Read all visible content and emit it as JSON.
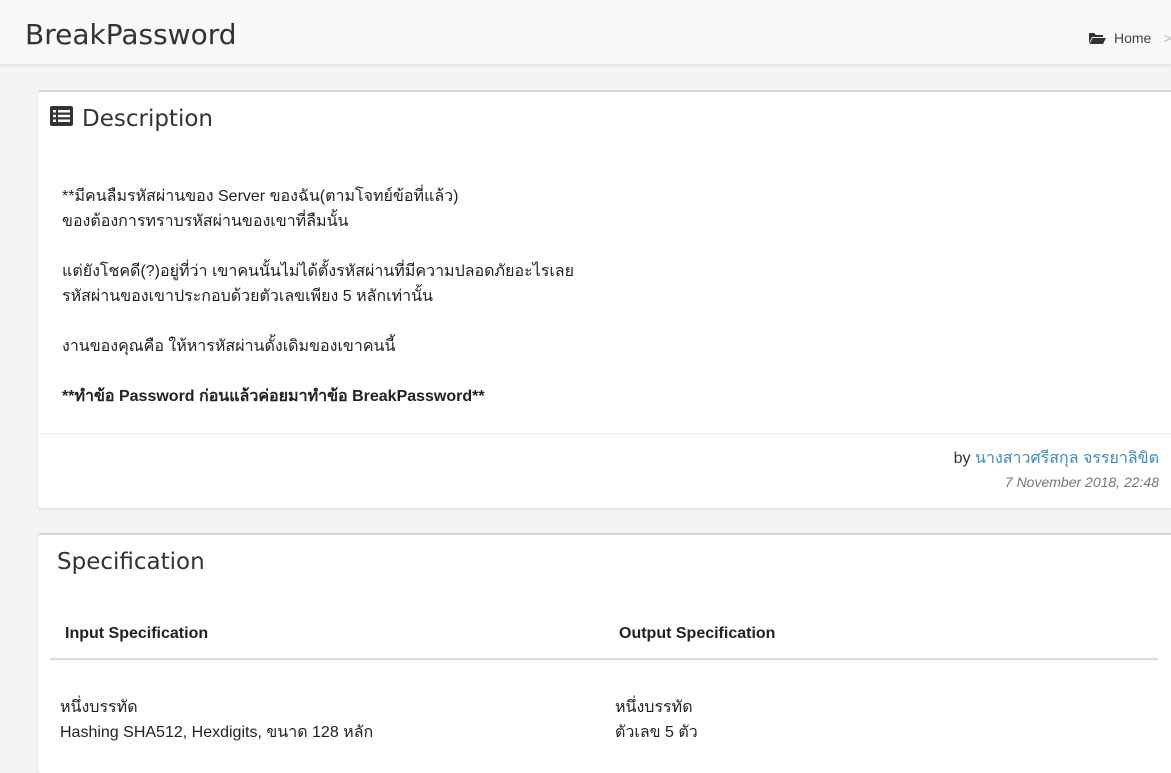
{
  "header": {
    "title": "BreakPassword",
    "breadcrumb": {
      "home_label": "Home",
      "separator": ">"
    }
  },
  "description": {
    "title": "Description",
    "lines": [
      "**มีคนลืมรหัสผ่านของ Server ของฉัน(ตามโจทย์ข้อที่แล้ว)",
      "ของต้องการทราบรหัสผ่านของเขาที่ลืมนั้น",
      "แต่ยังโชคดี(?)อยู่ที่ว่า เขาคนนั้นไม่ได้ตั้งรหัสผ่านที่มีความปลอดภัยอะไรเลย",
      "รหัสผ่านของเขาประกอบด้วยตัวเลขเพียง 5 หลักเท่านั้น",
      "งานของคุณคือ ให้หารหัสผ่านดั้งเดิมของเขาคนนี้",
      "**ทำข้อ Password ก่อนแล้วค่อยมาทำข้อ BreakPassword**"
    ],
    "by_label": "by",
    "author": "นางสาวศรีสกุล จรรยาลิขิต",
    "timestamp": "7 November 2018, 22:48"
  },
  "specification": {
    "title": "Specification",
    "input_header": "Input Specification",
    "output_header": "Output Specification",
    "input_lines": [
      "หนึ่งบรรทัด",
      "Hashing SHA512, Hexdigits, ขนาด 128 หลัก"
    ],
    "output_lines": [
      "หนึ่งบรรทัด",
      "ตัวเลข 5 ตัว"
    ]
  },
  "colors": {
    "link": "#3c8dbc",
    "box_border": "#d2d6de",
    "background": "#f4f4f4"
  }
}
